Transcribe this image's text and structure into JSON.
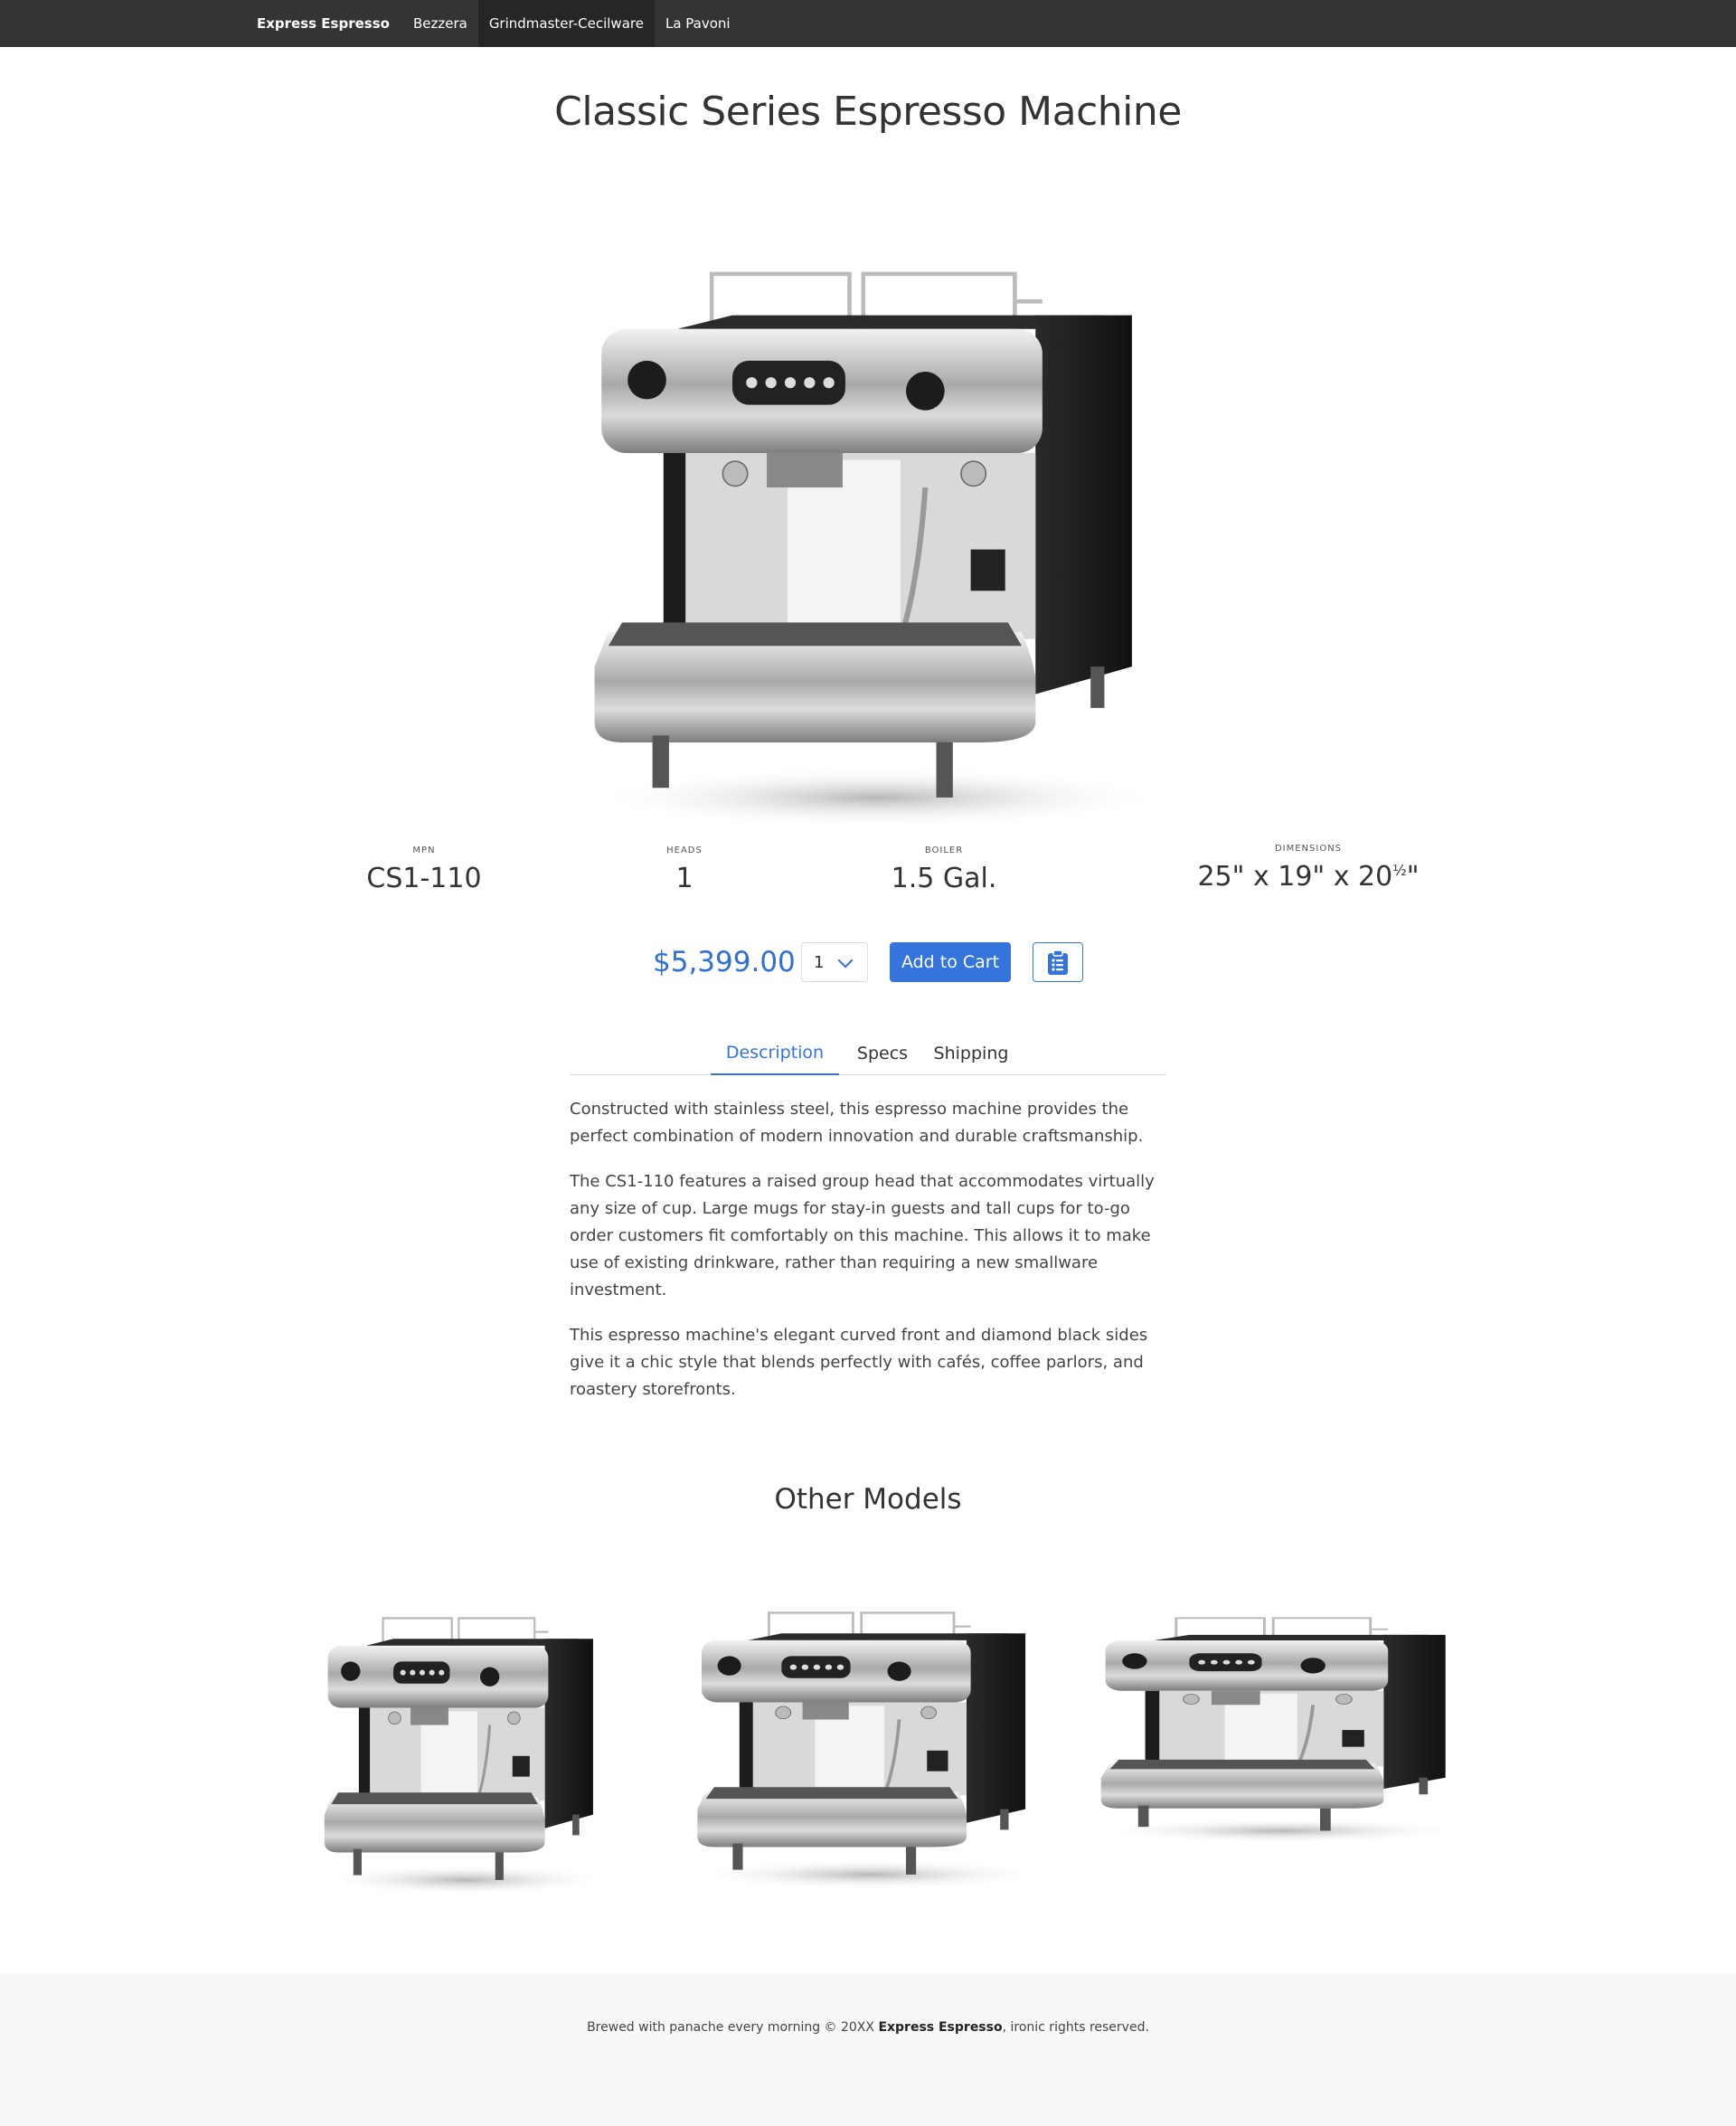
{
  "nav": {
    "brand": "Express Espresso",
    "links": [
      {
        "label": "Bezzera",
        "active": false
      },
      {
        "label": "Grindmaster-Cecilware",
        "active": true
      },
      {
        "label": "La Pavoni",
        "active": false
      }
    ]
  },
  "product": {
    "title": "Classic Series Espresso Machine",
    "image_alt": "single-group espresso machine",
    "specs": [
      {
        "label": "MPN",
        "value": "CS1-110"
      },
      {
        "label": "Heads",
        "value": "1"
      },
      {
        "label": "Boiler",
        "value": "1.5 Gal."
      },
      {
        "label": "Dimensions",
        "value": "25\" x 19\" x 20",
        "fraction": "½",
        "suffix": "\""
      }
    ],
    "price": "$5,399.00",
    "quantity": "1",
    "add_to_cart_label": "Add to Cart",
    "list_icon": "clipboard-list-icon"
  },
  "tabs": [
    {
      "label": "Description",
      "active": true
    },
    {
      "label": "Specs",
      "active": false
    },
    {
      "label": "Shipping",
      "active": false
    }
  ],
  "description": [
    "Constructed with stainless steel, this espresso machine provides the perfect combination of modern innovation and durable craftsmanship.",
    "The CS1-110 features a raised group head that accommodates virtually any size of cup. Large mugs for stay-in guests and tall cups for to-go order customers fit comfortably on this machine. This allows it to make use of existing drinkware, rather than requiring a new smallware investment.",
    "This espresso machine's elegant curved front and diamond black sides give it a chic style that blends perfectly with cafés, coffee parlors, and roastery storefronts."
  ],
  "other_models": {
    "title": "Other Models",
    "items": [
      {
        "alt": "single-group model"
      },
      {
        "alt": "two-group model"
      },
      {
        "alt": "three-group model"
      }
    ]
  },
  "footer": {
    "prefix": "Brewed with panache every morning © 20XX ",
    "brand": "Express Espresso",
    "suffix": ", ironic rights reserved."
  },
  "colors": {
    "accent": "#3474dc",
    "nav_bg": "#343434",
    "nav_active_bg": "#262626",
    "footer_bg": "#f8f8f8"
  }
}
